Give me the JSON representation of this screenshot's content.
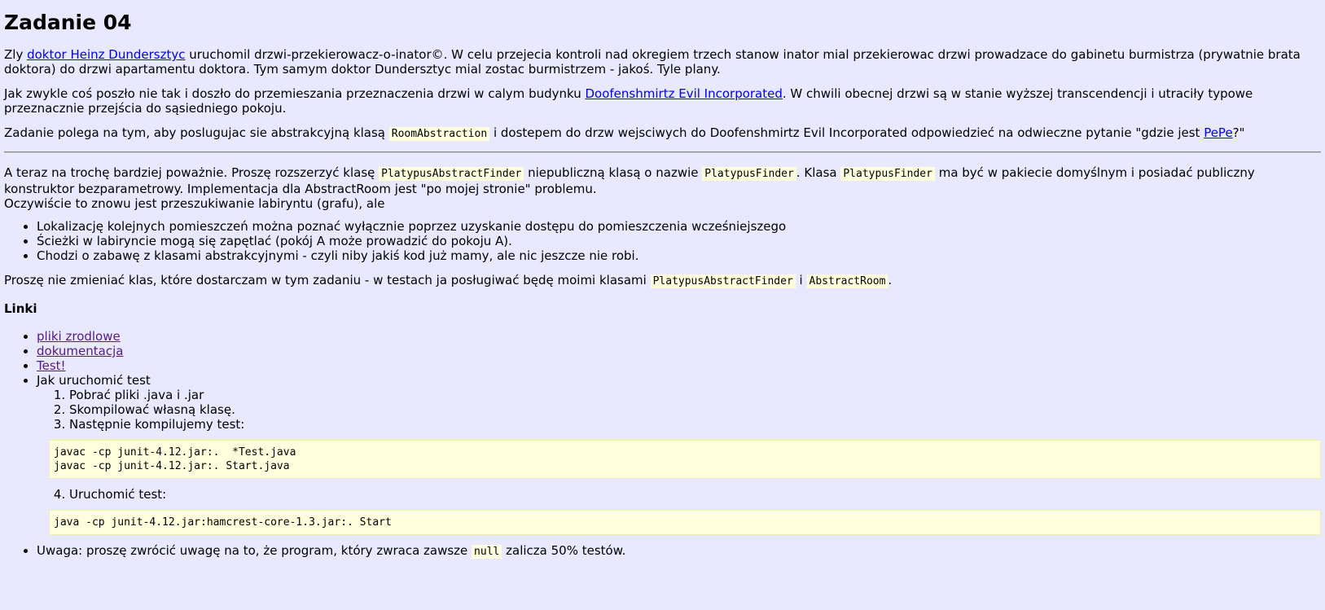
{
  "title": "Zadanie 04",
  "p1": {
    "t1": "Zly ",
    "link": "doktor Heinz Dundersztyc",
    "t2": " uruchomil drzwi-przekierowacz-o-inator©. W celu przejecia kontroli nad okregiem trzech stanow inator mial przekierowac drzwi prowadzace do gabinetu burmistrza (prywatnie brata doktora) do drzwi apartamentu doktora. Tym samym doktor Dundersztyc mial zostac burmistrzem - jakoś. Tyle plany."
  },
  "p2": {
    "t1": "Jak zwykle coś poszło nie tak i doszło do przemieszania przeznaczenia drzwi w calym budynku ",
    "link": "Doofenshmirtz Evil Incorporated",
    "t2": ". W chwili obecnej drzwi są w stanie wyższej transcendencji i utraciły typowe przeznacznie przejścia do sąsiedniego pokoju."
  },
  "p3": {
    "t1": "Zadanie polega na tym, aby poslugujac sie abstrakcyjną klasą ",
    "code": "RoomAbstraction",
    "t2": " i dostepem do drzw wejsciwych do Doofenshmirtz Evil Incorporated odpowiedzieć na odwieczne pytanie \"gdzie jest ",
    "link": "PePe",
    "t3": "?\""
  },
  "p4": {
    "t1": "A teraz na trochę bardziej poważnie. Proszę rozszerzyć klasę ",
    "code1": "PlatypusAbstractFinder",
    "t2": " niepubliczną klasą o nazwie ",
    "code2": "PlatypusFinder",
    "t3": ". Klasa ",
    "code3": "PlatypusFinder",
    "t4": " ma być w pakiecie domyślnym i posiadać publiczny konstruktor bezparametrowy. Implementacja dla AbstractRoom jest \"po mojej stronie\" problemu.",
    "t5": "Oczywiście to znowu jest przeszukiwanie labiryntu (grafu), ale"
  },
  "bullets": [
    "Lokalizację kolejnych pomieszczeń można poznać wyłącznie poprzez uzyskanie dostępu do pomieszczenia wcześniejszego",
    "Ścieżki w labiryncie mogą się zapętlać (pokój A może prowadzić do pokoju A).",
    "Chodzi o zabawę z klasami abstrakcyjnymi - czyli niby jakiś kod już mamy, ale nic jeszcze nie robi."
  ],
  "p5": {
    "t1": "Proszę nie zmieniać klas, które dostarczam w tym zadaniu - w testach ja posługiwać będę moimi klasami ",
    "code1": "PlatypusAbstractFinder",
    "t2": " i ",
    "code2": "AbstractRoom",
    "t3": "."
  },
  "links_heading": "Linki",
  "links": {
    "sources": "pliki zrodlowe",
    "docs": "dokumentacja",
    "test": "Test!",
    "howto": "Jak uruchomić test",
    "steps": [
      "Pobrać pliki .java i .jar",
      "Skompilować własną klasę.",
      "Następnie kompilujemy test:",
      "Uruchomić test:"
    ],
    "compile_cmd": "javac -cp junit-4.12.jar:.  *Test.java\njavac -cp junit-4.12.jar:. Start.java",
    "run_cmd": "java -cp junit-4.12.jar:hamcrest-core-1.3.jar:. Start"
  },
  "note": {
    "t1": "Uwaga: proszę zwrócić uwagę na to, że program, który zwraca zawsze ",
    "code": "null",
    "t2": " zalicza 50% testów."
  }
}
